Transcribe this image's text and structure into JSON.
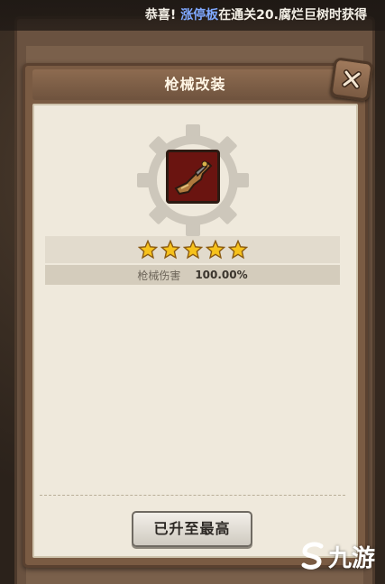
{
  "notice": {
    "prefix": "恭喜!",
    "player_name": "涨停板",
    "suffix": "在通关20.腐烂巨树时获得"
  },
  "dialog": {
    "title": "枪械改装",
    "close_icon": "close-x-icon",
    "weapon_icon": "rifle-icon",
    "star_rating": 5,
    "star_max": 5,
    "stat_label": "枪械伤害",
    "stat_value": "100.00%",
    "max_button_label": "已升至最高"
  },
  "watermark": {
    "text": "九游",
    "logo_icon": "jiuyou-s-logo"
  },
  "colors": {
    "star_gold": "#f6c21c",
    "panel_brown": "#7a5b43",
    "paper": "#efe9dc",
    "highlight_blue": "#7fa8ff"
  }
}
